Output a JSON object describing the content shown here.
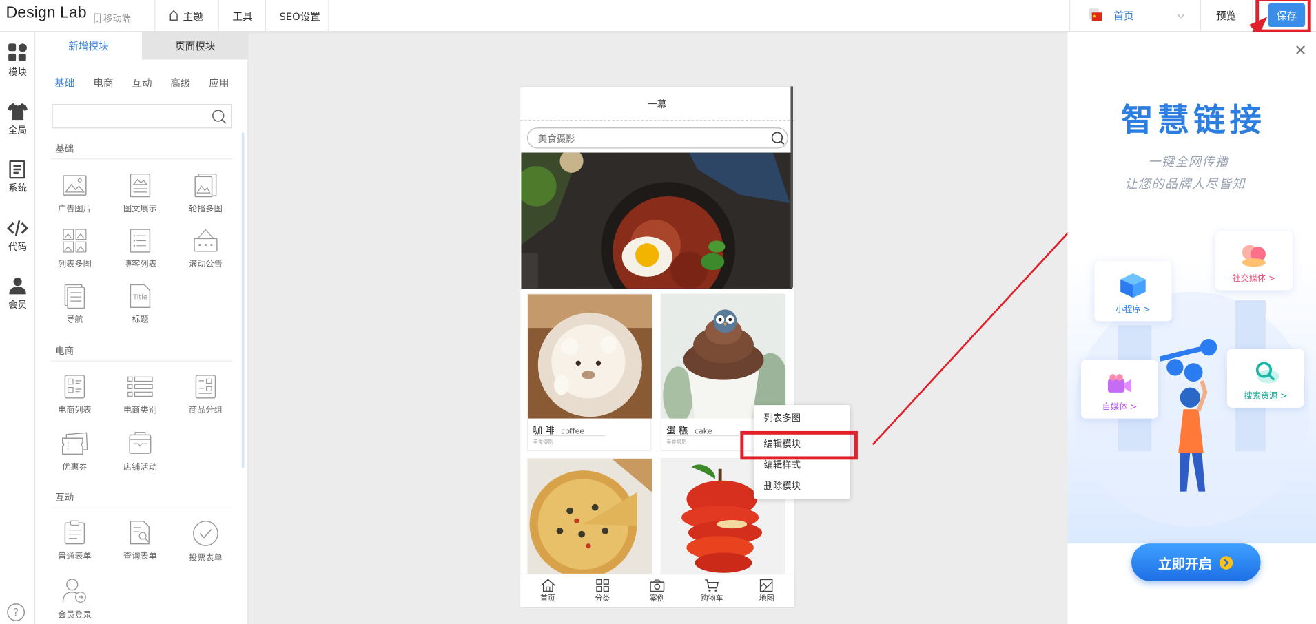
{
  "topbar": {
    "logo": "Design Lab",
    "device_label": "移动端",
    "nav": [
      "主题",
      "工具",
      "SEO设置"
    ],
    "page_select": "首页",
    "preview_label": "预览",
    "save_label": "保存"
  },
  "rail": [
    "模块",
    "全局",
    "系统",
    "代码",
    "会员"
  ],
  "panel": {
    "tabs": [
      "新增模块",
      "页面模块"
    ],
    "subtabs": [
      "基础",
      "电商",
      "互动",
      "高级",
      "应用"
    ],
    "sections": {
      "basic": {
        "title": "基础",
        "items": [
          "广告图片",
          "图文展示",
          "轮播多图",
          "列表多图",
          "博客列表",
          "滚动公告",
          "导航",
          "标题"
        ]
      },
      "ecom": {
        "title": "电商",
        "items": [
          "电商列表",
          "电商类别",
          "商品分组",
          "优惠券",
          "店铺活动"
        ]
      },
      "interact": {
        "title": "互动",
        "items": [
          "普通表单",
          "查询表单",
          "投票表单",
          "会员登录"
        ]
      }
    },
    "title_icon_text": "Title"
  },
  "phone": {
    "title": "一幕",
    "search_placeholder": "美食摄影",
    "cards": [
      {
        "title": "咖 啡",
        "sub": "coffee",
        "caption": "美食摄影"
      },
      {
        "title": "蛋 糕",
        "sub": "cake",
        "caption": "美食摄影"
      }
    ],
    "tabbar": [
      "首页",
      "分类",
      "案例",
      "购物车",
      "地图"
    ]
  },
  "context_menu": [
    "列表多图",
    "编辑模块",
    "编辑样式",
    "删除模块"
  ],
  "ad": {
    "title": "智慧链接",
    "line1": "一键全网传播",
    "line2": "让您的品牌人尽皆知",
    "cards": [
      "小程序 >",
      "社交媒体 >",
      "自媒体 >",
      "搜索资源 >"
    ],
    "cta": "立即开启"
  },
  "colors": {
    "accent": "#3a8de8",
    "highlight": "#e0202a",
    "ad_title": "#2c7fe0"
  }
}
